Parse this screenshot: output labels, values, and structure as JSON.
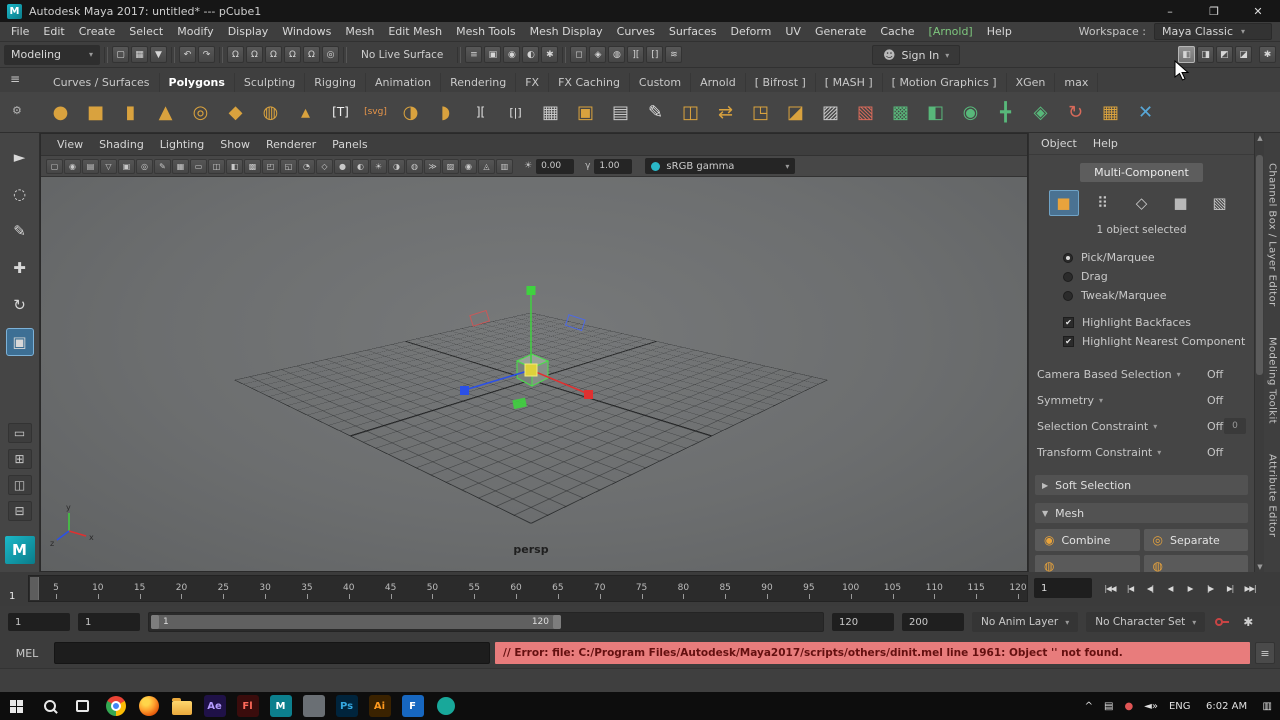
{
  "window": {
    "title": "Autodesk Maya 2017: untitled*  ---  pCube1",
    "minimize": "–",
    "restore": "❐",
    "close": "✕"
  },
  "menubar": {
    "items": [
      "File",
      "Edit",
      "Create",
      "Select",
      "Modify",
      "Display",
      "Windows",
      "Mesh",
      "Edit Mesh",
      "Mesh Tools",
      "Mesh Display",
      "Curves",
      "Surfaces",
      "Deform",
      "UV",
      "Generate",
      "Cache",
      "[Arnold]",
      "Help"
    ],
    "workspace_label": "Workspace :",
    "workspace_value": "Maya Classic"
  },
  "statusline": {
    "menuset": "Modeling",
    "live_surface": "No Live Surface",
    "signin": "Sign In",
    "file_icons": [
      {
        "n": "new-scene-icon",
        "g": "▢"
      },
      {
        "n": "open-scene-icon",
        "g": "▦"
      },
      {
        "n": "save-scene-icon",
        "g": "▼"
      }
    ],
    "edit_icons": [
      {
        "n": "undo-icon",
        "g": "↶"
      },
      {
        "n": "redo-icon",
        "g": "↷"
      }
    ],
    "snap_icons": [
      {
        "n": "snap-to-grid-icon",
        "g": "Ω"
      },
      {
        "n": "snap-to-curve-icon",
        "g": "Ω"
      },
      {
        "n": "snap-to-point-icon",
        "g": "Ω"
      },
      {
        "n": "snap-to-projected-center-icon",
        "g": "Ω"
      },
      {
        "n": "snap-to-view-plane-icon",
        "g": "Ω"
      },
      {
        "n": "make-live-icon",
        "g": "◎"
      }
    ],
    "render_icons": [
      {
        "n": "construction-history-icon",
        "g": "≡"
      },
      {
        "n": "open-render-view-icon",
        "g": "▣"
      },
      {
        "n": "render-current-frame-icon",
        "g": "◉"
      },
      {
        "n": "ipr-render-icon",
        "g": "◐"
      },
      {
        "n": "render-settings-icon",
        "g": "✱"
      }
    ],
    "selection_icons": [
      {
        "n": "object-mask-icon",
        "g": "◻"
      },
      {
        "n": "component-mask-icon",
        "g": "◈"
      },
      {
        "n": "animation-mask-icon",
        "g": "◍"
      },
      {
        "n": "symmetry-toggle-icon",
        "g": "]["
      },
      {
        "n": "fast-interaction-icon",
        "g": "[]"
      },
      {
        "n": "input-line-icon",
        "g": "≋"
      }
    ],
    "right_icons": [
      {
        "n": "workspace-outliner-icon",
        "g": "◧",
        "hover": true
      },
      {
        "n": "workspace-channel-box-icon",
        "g": "◨"
      },
      {
        "n": "workspace-attr-editor-icon",
        "g": "◩"
      },
      {
        "n": "workspace-tool-settings-icon",
        "g": "◪"
      }
    ],
    "settings_icon": {
      "n": "ui-settings-icon",
      "g": "✱"
    }
  },
  "shelf": {
    "tabs": [
      {
        "label": "Curves / Surfaces"
      },
      {
        "label": "Polygons",
        "active": true
      },
      {
        "label": "Sculpting"
      },
      {
        "label": "Rigging"
      },
      {
        "label": "Animation"
      },
      {
        "label": "Rendering"
      },
      {
        "label": "FX"
      },
      {
        "label": "FX Caching"
      },
      {
        "label": "Custom"
      },
      {
        "label": "Arnold"
      },
      {
        "label": "[ Bifrost ]"
      },
      {
        "label": "[ MASH ]"
      },
      {
        "label": "[ Motion Graphics ]"
      },
      {
        "label": "XGen"
      },
      {
        "label": "max"
      }
    ],
    "icons": [
      {
        "n": "poly-sphere-icon",
        "g": "●",
        "c": "#d9a23e"
      },
      {
        "n": "poly-cube-icon",
        "g": "■",
        "c": "#d9a23e"
      },
      {
        "n": "poly-cylinder-icon",
        "g": "▮",
        "c": "#d9a23e"
      },
      {
        "n": "poly-cone-icon",
        "g": "▲",
        "c": "#d9a23e"
      },
      {
        "n": "poly-torus-icon",
        "g": "◎",
        "c": "#d9a23e"
      },
      {
        "n": "poly-plane-icon",
        "g": "◆",
        "c": "#d9a23e"
      },
      {
        "n": "poly-disc-icon",
        "g": "◍",
        "c": "#d9a23e"
      },
      {
        "n": "poly-pyramid-icon",
        "g": "▴",
        "c": "#d9a23e"
      },
      {
        "n": "type-tool-icon",
        "g": "[T]",
        "c": "#f0f0f0",
        "fs": 12
      },
      {
        "n": "svg-tool-icon",
        "g": "[svg]",
        "c": "#e8964a",
        "fs": 9
      },
      {
        "n": "poly-ball-icon",
        "g": "◑",
        "c": "#d9a23e"
      },
      {
        "n": "poly-half-sphere-icon",
        "g": "◗",
        "c": "#d9a23e"
      },
      {
        "n": "bracket-a-icon",
        "g": "][",
        "c": "#e0e0e0",
        "fs": 12
      },
      {
        "n": "bracket-b-icon",
        "g": "[|]",
        "c": "#e0e0e0",
        "fs": 11
      },
      {
        "n": "poly-grid-icon",
        "g": "▦",
        "c": "#c8c8c8"
      },
      {
        "n": "smooth-cube-icon",
        "g": "▣",
        "c": "#d9a23e"
      },
      {
        "n": "lattice-icon",
        "g": "▤",
        "c": "#c8c8c8"
      },
      {
        "n": "append-pencil-icon",
        "g": "✎",
        "c": "#e0e0e0"
      },
      {
        "n": "mirror-geometry-icon",
        "g": "◫",
        "c": "#d9a23e"
      },
      {
        "n": "merge-vertices-icon",
        "g": "⇄",
        "c": "#d9a23e"
      },
      {
        "n": "extrude-icon",
        "g": "◳",
        "c": "#d9a23e"
      },
      {
        "n": "slice-cube-icon",
        "g": "◪",
        "c": "#d9a23e"
      },
      {
        "n": "dashed-cube-icon",
        "g": "▨",
        "c": "#c8c8c8"
      },
      {
        "n": "delete-component-icon",
        "g": "▧",
        "c": "#d86a5a"
      },
      {
        "n": "quad-draw-icon",
        "g": "▩",
        "c": "#58b87a"
      },
      {
        "n": "multi-cut-icon",
        "g": "◧",
        "c": "#58b87a"
      },
      {
        "n": "target-weld-icon",
        "g": "◉",
        "c": "#58b87a"
      },
      {
        "n": "connect-icon",
        "g": "╋",
        "c": "#58b87a"
      },
      {
        "n": "crease-icon",
        "g": "◈",
        "c": "#58b87a"
      },
      {
        "n": "spin-edge-icon",
        "g": "↻",
        "c": "#d86a5a"
      },
      {
        "n": "grid-tool-icon",
        "g": "▦",
        "c": "#d9a23e"
      },
      {
        "n": "transform-constraint-icon",
        "g": "✕",
        "c": "#58a8d8"
      }
    ]
  },
  "toolbox": {
    "tools": [
      {
        "n": "select-tool",
        "g": "►"
      },
      {
        "n": "lasso-tool",
        "g": "◌"
      },
      {
        "n": "paint-select-tool",
        "g": "✎"
      },
      {
        "n": "move-tool",
        "g": "✚"
      },
      {
        "n": "rotate-tool",
        "g": "↻"
      },
      {
        "n": "scale-tool",
        "g": "▣",
        "active": true
      }
    ],
    "layout_buttons": [
      {
        "n": "layout-single-pane-button",
        "g": "▭"
      },
      {
        "n": "layout-four-pane-button",
        "g": "⊞"
      },
      {
        "n": "layout-split-pane-button",
        "g": "◫"
      },
      {
        "n": "layout-outliner-pane-button",
        "g": "⊟"
      }
    ]
  },
  "viewport": {
    "menus": [
      "View",
      "Shading",
      "Lighting",
      "Show",
      "Renderer",
      "Panels"
    ],
    "icons": [
      {
        "n": "select-camera-icon",
        "g": "▢"
      },
      {
        "n": "lock-camera-icon",
        "g": "◉"
      },
      {
        "n": "camera-attributes-icon",
        "g": "▤"
      },
      {
        "n": "bookmarks-icon",
        "g": "▽"
      },
      {
        "n": "image-plane-icon",
        "g": "▣"
      },
      {
        "n": "two-d-pan-zoom-icon",
        "g": "◎"
      },
      {
        "n": "grease-pencil-icon",
        "g": "✎"
      },
      {
        "n": "grid-toggle-icon",
        "g": "▦"
      },
      {
        "n": "film-gate-icon",
        "g": "▭"
      },
      {
        "n": "resolution-gate-icon",
        "g": "◫"
      },
      {
        "n": "gate-mask-icon",
        "g": "◧"
      },
      {
        "n": "field-chart-icon",
        "g": "▩"
      },
      {
        "n": "safe-action-icon",
        "g": "◰"
      },
      {
        "n": "safe-title-icon",
        "g": "◱"
      },
      {
        "n": "highlight-selection-icon",
        "g": "◔"
      },
      {
        "n": "wireframe-icon",
        "g": "◇"
      },
      {
        "n": "shaded-icon",
        "g": "●"
      },
      {
        "n": "textured-icon",
        "g": "◐"
      },
      {
        "n": "use-all-lights-icon",
        "g": "☀"
      },
      {
        "n": "shadows-icon",
        "g": "◑"
      },
      {
        "n": "screen-space-ao-icon",
        "g": "◍"
      },
      {
        "n": "motion-blur-icon",
        "g": "≫"
      },
      {
        "n": "multisample-icon",
        "g": "▨"
      },
      {
        "n": "depth-of-field-icon",
        "g": "◉"
      },
      {
        "n": "isolate-select-icon",
        "g": "◬"
      },
      {
        "n": "xray-icon",
        "g": "▥"
      }
    ],
    "exposure": "0.00",
    "gamma": "1.00",
    "colorspace": "sRGB gamma",
    "camera_label": "persp"
  },
  "toolkit": {
    "menus": [
      "Object",
      "Help"
    ],
    "tab": "Multi-Component",
    "modes": [
      {
        "n": "object-mode-button",
        "g": "■",
        "c": "#e8a33c",
        "active": true
      },
      {
        "n": "vertex-mode-button",
        "g": "⠿",
        "c": "#c8c8c8"
      },
      {
        "n": "edge-mode-button",
        "g": "◇",
        "c": "#c8c8c8"
      },
      {
        "n": "face-mode-button",
        "g": "■",
        "c": "#b8b8b8"
      },
      {
        "n": "uv-mode-button",
        "g": "▧",
        "c": "#c8c8c8"
      }
    ],
    "selection_info": "1 object selected",
    "radios": [
      {
        "label": "Pick/Marquee",
        "selected": true
      },
      {
        "label": "Drag",
        "selected": false
      },
      {
        "label": "Tweak/Marquee",
        "selected": false
      }
    ],
    "checkboxes": [
      {
        "label": "Highlight Backfaces",
        "checked": true
      },
      {
        "label": "Highlight Nearest Component",
        "checked": true
      }
    ],
    "dropdown_rows": [
      {
        "label": "Camera Based Selection",
        "value": "Off"
      },
      {
        "label": "Symmetry",
        "value": "Off"
      },
      {
        "label": "Selection Constraint",
        "value": "Off",
        "extra": "0"
      },
      {
        "label": "Transform Constraint",
        "value": "Off"
      }
    ],
    "sections": [
      {
        "label": "Soft Selection",
        "collapsed": true
      },
      {
        "label": "Mesh",
        "collapsed": false
      }
    ],
    "mesh_buttons": [
      "Combine",
      "Separate"
    ]
  },
  "edge_tabs": [
    "Channel Box / Layer Editor",
    "Modeling Toolkit",
    "Attribute Editor"
  ],
  "timeslider": {
    "current_label": "1",
    "ticks": [
      5,
      10,
      15,
      20,
      25,
      30,
      35,
      40,
      45,
      50,
      55,
      60,
      65,
      70,
      75,
      80,
      85,
      90,
      95,
      100,
      105,
      110,
      115,
      120
    ],
    "current_field": "1",
    "playback": [
      {
        "n": "go-to-start-button",
        "g": "|◀◀"
      },
      {
        "n": "step-back-key-button",
        "g": "|◀"
      },
      {
        "n": "step-back-frame-button",
        "g": "◀|"
      },
      {
        "n": "play-backwards-button",
        "g": "◀"
      },
      {
        "n": "play-forwards-button",
        "g": "▶"
      },
      {
        "n": "step-forward-frame-button",
        "g": "|▶"
      },
      {
        "n": "step-forward-key-button",
        "g": "▶|"
      },
      {
        "n": "go-to-end-button",
        "g": "▶▶|"
      }
    ]
  },
  "rangeslider": {
    "animation_start": "1",
    "playback_start": "1",
    "bar_start_label": "1",
    "bar_end_label": "120",
    "playback_end": "120",
    "animation_end": "200",
    "anim_layer": "No Anim Layer",
    "character_set": "No Character Set"
  },
  "commandline": {
    "label": "MEL",
    "error": "// Error: file: C:/Program Files/Autodesk/Maya2017/scripts/others/dinit.mel line 1961: Object '' not found."
  },
  "taskbar": {
    "apps": [
      {
        "n": "start-button",
        "type": "winlogo"
      },
      {
        "n": "search-button",
        "type": "search"
      },
      {
        "n": "task-view-button",
        "type": "taskview"
      },
      {
        "n": "browser-icon",
        "type": "chrome"
      },
      {
        "n": "firefox-icon",
        "type": "firefox"
      },
      {
        "n": "file-explorer-icon",
        "type": "folder"
      },
      {
        "n": "after-effects-icon",
        "type": "square",
        "label": "Ae",
        "bg": "#1f1147",
        "fg": "#b49bff"
      },
      {
        "n": "flash-icon",
        "type": "square",
        "label": "Fl",
        "bg": "#3a0c0c",
        "fg": "#ff6a5a"
      },
      {
        "n": "maya-icon",
        "type": "square",
        "label": "M",
        "bg": "#0c7f8d",
        "fg": "#ffffff"
      },
      {
        "n": "gray-app-icon",
        "type": "square",
        "label": "",
        "bg": "#6a6f74",
        "fg": "#ffffff"
      },
      {
        "n": "photoshop-icon",
        "type": "square",
        "label": "Ps",
        "bg": "#00243c",
        "fg": "#34a8e0"
      },
      {
        "n": "illustrator-icon",
        "type": "square",
        "label": "Ai",
        "bg": "#3a2200",
        "fg": "#ff9a1e"
      },
      {
        "n": "blue-app-icon",
        "type": "square",
        "label": "F",
        "bg": "#1767c0",
        "fg": "#ffffff"
      },
      {
        "n": "teal-app-icon",
        "type": "circle",
        "bg": "#18a89a"
      }
    ],
    "tray": [
      {
        "n": "tray-expand-icon",
        "g": "^"
      },
      {
        "n": "tray-app-icon",
        "g": "▤"
      },
      {
        "n": "security-center-icon",
        "g": "●",
        "c": "#e05555"
      },
      {
        "n": "volume-icon",
        "g": "◄»"
      }
    ],
    "lang": "ENG",
    "time": "6:02 AM",
    "notification_icon": "▥"
  },
  "colors": {
    "accent": "#4f7ea0",
    "shelf_gold": "#d9a23e",
    "shelf_green": "#58b87a",
    "axis_x": "#e03030",
    "axis_y": "#3fd23f",
    "axis_z": "#2b50e8",
    "error_bg": "#e87c7c"
  }
}
